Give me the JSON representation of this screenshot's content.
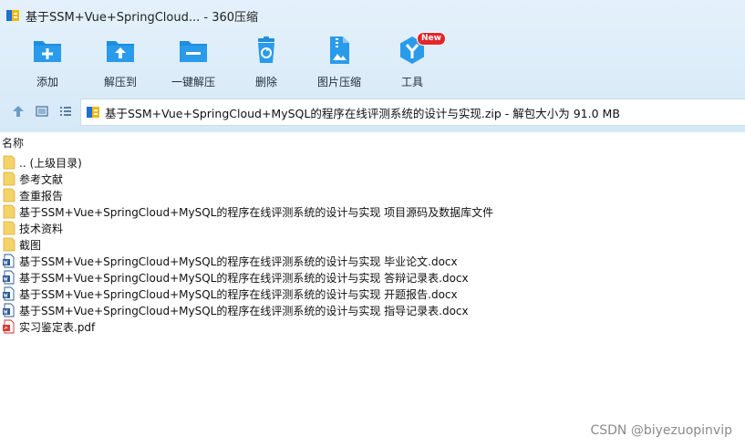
{
  "window": {
    "title": "基于SSM+Vue+SpringCloud... - 360压缩"
  },
  "toolbar": {
    "items": [
      {
        "label": "添加",
        "icon": "add-icon"
      },
      {
        "label": "解压到",
        "icon": "extract-to-icon"
      },
      {
        "label": "一键解压",
        "icon": "one-click-extract-icon"
      },
      {
        "label": "删除",
        "icon": "delete-icon"
      },
      {
        "label": "图片压缩",
        "icon": "image-compress-icon"
      },
      {
        "label": "工具",
        "icon": "tools-icon",
        "badge": "New"
      }
    ],
    "accent_color": "#1e8ee0"
  },
  "address": {
    "path": "基于SSM+Vue+SpringCloud+MySQL的程序在线评测系统的设计与实现.zip - 解包大小为 91.0 MB"
  },
  "filelist": {
    "column_header": "名称",
    "rows": [
      {
        "name": ".. (上级目录)",
        "type": "folder"
      },
      {
        "name": "参考文献",
        "type": "folder"
      },
      {
        "name": "查重报告",
        "type": "folder"
      },
      {
        "name": "基于SSM+Vue+SpringCloud+MySQL的程序在线评测系统的设计与实现 项目源码及数据库文件",
        "type": "folder"
      },
      {
        "name": "技术资料",
        "type": "folder"
      },
      {
        "name": "截图",
        "type": "folder"
      },
      {
        "name": "基于SSM+Vue+SpringCloud+MySQL的程序在线评测系统的设计与实现 毕业论文.docx",
        "type": "docx"
      },
      {
        "name": "基于SSM+Vue+SpringCloud+MySQL的程序在线评测系统的设计与实现 答辩记录表.docx",
        "type": "docx"
      },
      {
        "name": "基于SSM+Vue+SpringCloud+MySQL的程序在线评测系统的设计与实现 开题报告.docx",
        "type": "docx"
      },
      {
        "name": "基于SSM+Vue+SpringCloud+MySQL的程序在线评测系统的设计与实现 指导记录表.docx",
        "type": "docx"
      },
      {
        "name": "实习鉴定表.pdf",
        "type": "pdf"
      }
    ]
  },
  "watermark": "CSDN @biyezuopinvip"
}
